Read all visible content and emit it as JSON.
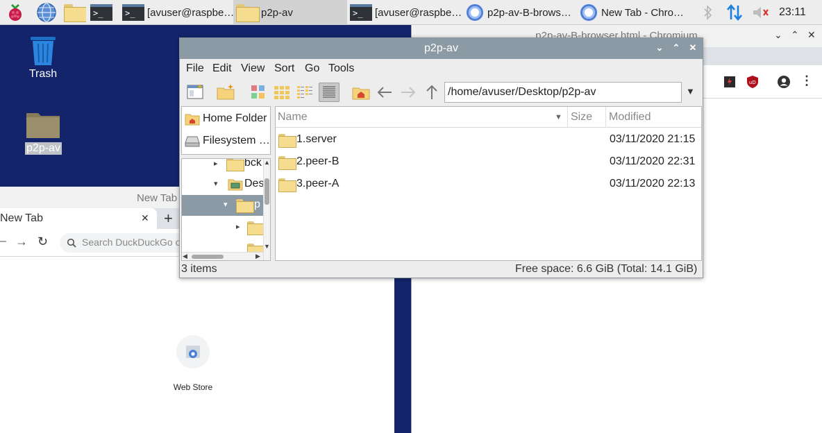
{
  "taskbar": {
    "items": [
      {
        "label": "[avuser@raspbe…"
      },
      {
        "label": "p2p-av"
      },
      {
        "label": "[avuser@raspbe…"
      },
      {
        "label": "p2p-av-B-brows…"
      },
      {
        "label": "New Tab - Chro…"
      }
    ],
    "clock": "23:11"
  },
  "desktop": {
    "icons": [
      {
        "label": "Trash"
      },
      {
        "label": "p2p-av"
      }
    ]
  },
  "chrome_left": {
    "window_title": "New Tab",
    "tab_label": "New Tab",
    "tab_close": "✕",
    "new_tab": "+",
    "omnibox_placeholder": "Search DuckDuckGo or",
    "webstore_label": "Web Store"
  },
  "chrome_right": {
    "window_title": "p2p-av-B-browser.html - Chromium"
  },
  "file_manager": {
    "title": "p2p-av",
    "menu": [
      "File",
      "Edit",
      "View",
      "Sort",
      "Go",
      "Tools"
    ],
    "path": "/home/avuser/Desktop/p2p-av",
    "places": [
      {
        "label": "Home Folder"
      },
      {
        "label": "Filesystem …"
      }
    ],
    "tree": [
      {
        "label": "bck"
      },
      {
        "label": "Des"
      },
      {
        "label": "p"
      }
    ],
    "columns": {
      "name": "Name",
      "size": "Size",
      "modified": "Modified"
    },
    "files": [
      {
        "name": "1.server",
        "size": "",
        "modified": "03/11/2020 21:15"
      },
      {
        "name": "2.peer-B",
        "size": "",
        "modified": "03/11/2020 22:31"
      },
      {
        "name": "3.peer-A",
        "size": "",
        "modified": "03/11/2020 22:13"
      }
    ],
    "status_items": "3 items",
    "status_free": "Free space: 6.6 GiB (Total: 14.1 GiB)"
  }
}
